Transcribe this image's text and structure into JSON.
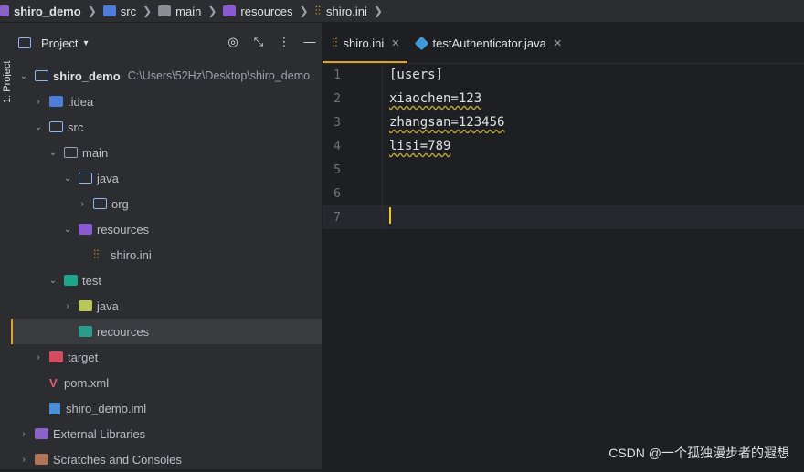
{
  "breadcrumbs": [
    {
      "label": "shiro_demo",
      "icon": "module-icon",
      "bold": true
    },
    {
      "label": "src",
      "icon": "source-folder-icon"
    },
    {
      "label": "main",
      "icon": "folder-icon"
    },
    {
      "label": "resources",
      "icon": "resources-folder-icon"
    },
    {
      "label": "shiro.ini",
      "icon": "ini-file-icon"
    }
  ],
  "left_strip": {
    "label": "1: Project"
  },
  "project_panel": {
    "title": "Project",
    "tree": [
      {
        "label": "shiro_demo",
        "hint": "C:\\Users\\52Hz\\Desktop\\shiro_demo",
        "bold": true
      },
      {
        "label": ".idea"
      },
      {
        "label": "src"
      },
      {
        "label": "main"
      },
      {
        "label": "java"
      },
      {
        "label": "org"
      },
      {
        "label": "resources"
      },
      {
        "label": "shiro.ini"
      },
      {
        "label": "test"
      },
      {
        "label": "java"
      },
      {
        "label": "recources"
      },
      {
        "label": "target"
      },
      {
        "label": "pom.xml"
      },
      {
        "label": "shiro_demo.iml"
      },
      {
        "label": "External Libraries"
      },
      {
        "label": "Scratches and Consoles"
      }
    ]
  },
  "editor": {
    "tabs": [
      {
        "label": "shiro.ini",
        "active": true
      },
      {
        "label": "testAuthenticator.java",
        "active": false
      }
    ],
    "lines": [
      {
        "num": "1",
        "text": "[users]"
      },
      {
        "num": "2",
        "text": "xiaochen=123"
      },
      {
        "num": "3",
        "text": "zhangsan=123456"
      },
      {
        "num": "4",
        "text": "lisi=789"
      },
      {
        "num": "5",
        "text": ""
      },
      {
        "num": "6",
        "text": ""
      },
      {
        "num": "7",
        "text": ""
      }
    ]
  },
  "watermark": "CSDN @一个孤独漫步者的遐想",
  "colors": {
    "accent": "#e2a32b",
    "panel": "#2b2d30",
    "editor_bg": "#1e1f22"
  }
}
